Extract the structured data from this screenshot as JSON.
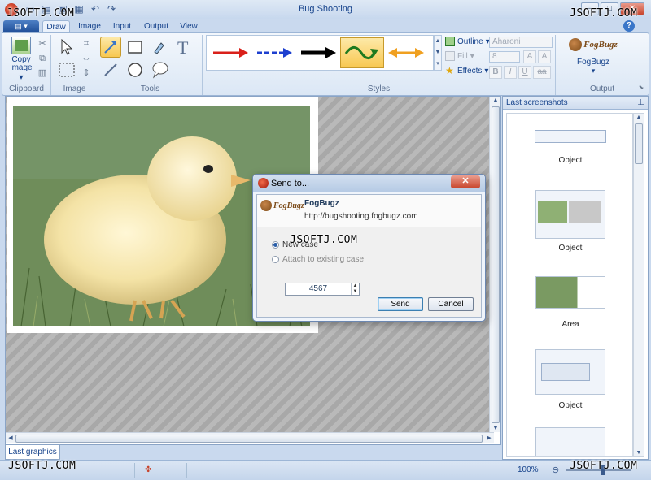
{
  "window": {
    "title": "Bug Shooting"
  },
  "watermarks": [
    "JSOFTJ.COM",
    "JSOFTJ.COM",
    "JSOFTJ.COM",
    "JSOFTJ.COM",
    "JSOFTJ.COM"
  ],
  "ribbon": {
    "tabs": [
      {
        "label": "Draw",
        "active": true
      },
      {
        "label": "Image",
        "active": false
      },
      {
        "label": "Input",
        "active": false
      },
      {
        "label": "Output",
        "active": false
      },
      {
        "label": "View",
        "active": false
      }
    ],
    "groups": {
      "clipboard": {
        "label": "Clipboard",
        "copy_label": "Copy image"
      },
      "image": {
        "label": "Image"
      },
      "tools": {
        "label": "Tools"
      },
      "styles": {
        "label": "Styles",
        "outline_label": "Outline",
        "fill_label": "Fill",
        "effects_label": "Effects",
        "font_name": "Aharoni",
        "font_size": "8",
        "format_bold": "B",
        "format_italic": "I",
        "format_underline": "U",
        "format_strike": "aa",
        "grow_font": "A",
        "shrink_font": "A",
        "arrow_styles": [
          {
            "color": "#d9201a",
            "dash": "none"
          },
          {
            "color": "#1d3fcf",
            "dash": "dashed"
          },
          {
            "color": "#000000",
            "dash": "none"
          },
          {
            "color": "#2e8b2e",
            "dash": "wave"
          },
          {
            "color": "#f0a020",
            "dash": "double"
          }
        ]
      },
      "output": {
        "label": "Output",
        "service_label": "FogBugz"
      }
    }
  },
  "main": {
    "bottom_tab": "Last graphics"
  },
  "panel": {
    "title": "Last screenshots",
    "items": [
      {
        "caption": "Object"
      },
      {
        "caption": "Object"
      },
      {
        "caption": "Area"
      },
      {
        "caption": "Object"
      },
      {
        "caption": ""
      }
    ]
  },
  "statusbar": {
    "zoom": "100%"
  },
  "dialog": {
    "title": "Send to...",
    "service_name": "FogBugz",
    "service_url": "http://bugshooting.fogbugz.com",
    "logo_text": "FogBugz",
    "option_new_case": "New case",
    "option_existing_case": "Attach to existing case",
    "case_number": "4567",
    "send_label": "Send",
    "cancel_label": "Cancel"
  }
}
